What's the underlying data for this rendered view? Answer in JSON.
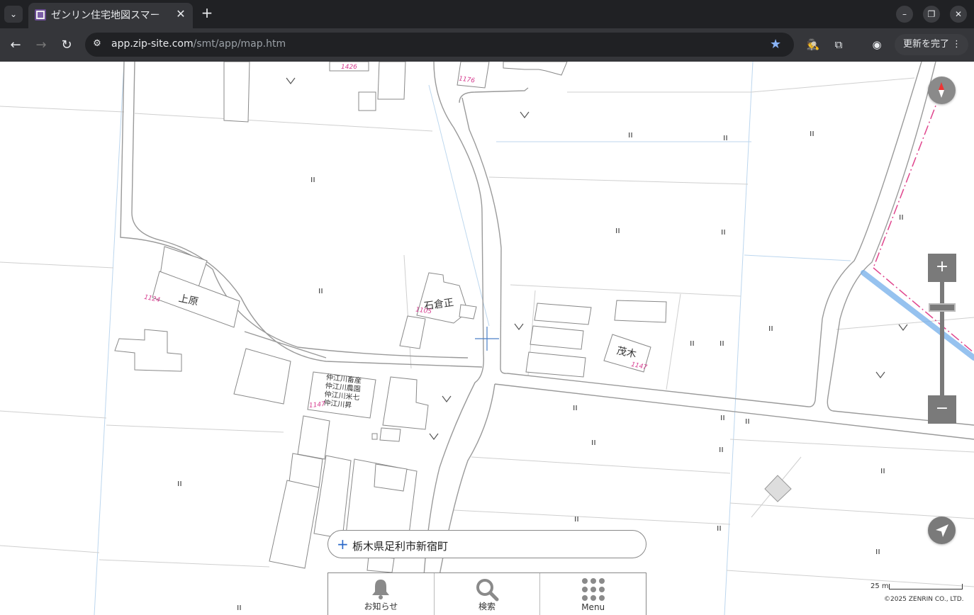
{
  "browser": {
    "tab_title": "ゼンリン住宅地図スマー",
    "url_host": "app.zip-site.com",
    "url_path": "/smt/app/map.htm",
    "update_button": "更新を完了",
    "colors": {
      "tabbar": "#202124",
      "toolbar": "#35363a",
      "star": "#8ab4f8"
    }
  },
  "map": {
    "labels": {
      "kamihara": "上原",
      "ishikura": "石倉正",
      "shigeki": "茂木",
      "shop_line1": "仲江川畜産",
      "shop_line2": "仲江川農園",
      "shop_line3": "仲江川米七",
      "shop_line4": "仲江川昇"
    },
    "lots": {
      "l1426": "1426",
      "l1176": "1176",
      "l1124": "1124",
      "l1105": "1105",
      "l1147a": "1147",
      "l1147b": "1147"
    },
    "field_mark": "ıı"
  },
  "address": "栃木県足利市新宿町",
  "menu": {
    "notice": "お知らせ",
    "search": "検索",
    "menu": "Menu"
  },
  "scale_label": "25 m",
  "copyright": "©2025 ZENRIN CO., LTD."
}
